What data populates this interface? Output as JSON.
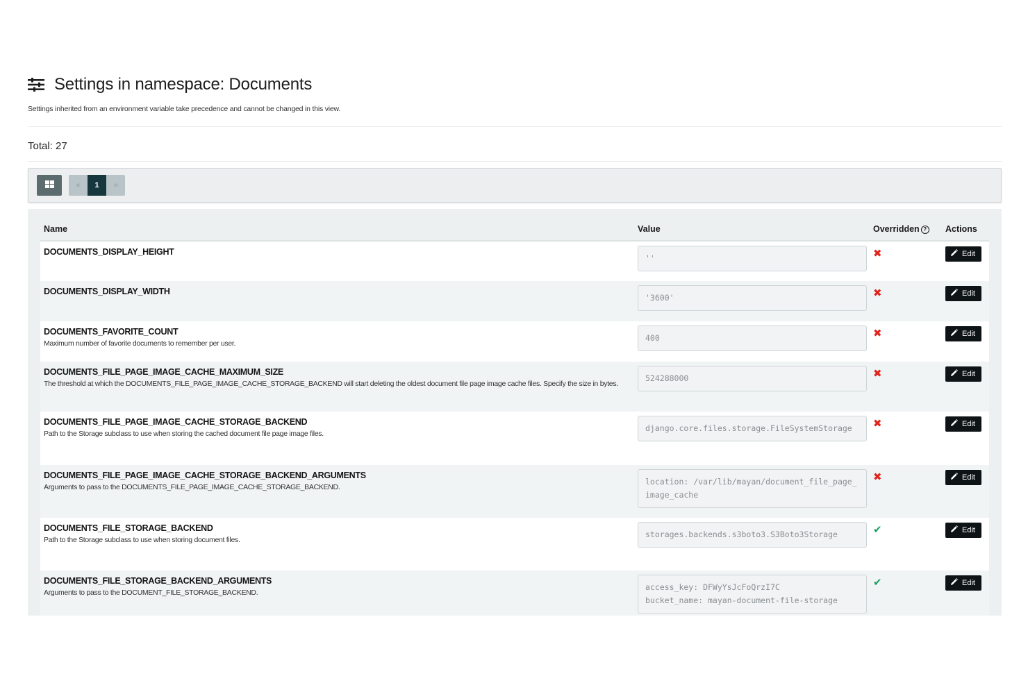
{
  "header": {
    "title": "Settings in namespace: Documents",
    "subtitle": "Settings inherited from an environment variable take precedence and cannot be changed in this view.",
    "icon": "sliders-icon"
  },
  "total_label": "Total: 27",
  "toolbar": {
    "view_icon": "grid-icon",
    "pager": {
      "prev": "«",
      "current": "1",
      "next": "»"
    }
  },
  "table": {
    "columns": {
      "name": "Name",
      "value": "Value",
      "overridden": "Overridden",
      "actions": "Actions"
    },
    "edit_label": "Edit",
    "rows": [
      {
        "name": "DOCUMENTS_DISPLAY_HEIGHT",
        "description": "",
        "value": "''",
        "overridden": false
      },
      {
        "name": "DOCUMENTS_DISPLAY_WIDTH",
        "description": "",
        "value": "'3600'",
        "overridden": false
      },
      {
        "name": "DOCUMENTS_FAVORITE_COUNT",
        "description": "Maximum number of favorite documents to remember per user.",
        "value": "400",
        "overridden": false
      },
      {
        "name": "DOCUMENTS_FILE_PAGE_IMAGE_CACHE_MAXIMUM_SIZE",
        "description": "The threshold at which the DOCUMENTS_FILE_PAGE_IMAGE_CACHE_STORAGE_BACKEND will start deleting the oldest document file page image cache files. Specify the size in bytes.",
        "value": "524288000",
        "overridden": false
      },
      {
        "name": "DOCUMENTS_FILE_PAGE_IMAGE_CACHE_STORAGE_BACKEND",
        "description": "Path to the Storage subclass to use when storing the cached document file page image files.",
        "value": "django.core.files.storage.FileSystemStorage",
        "overridden": false
      },
      {
        "name": "DOCUMENTS_FILE_PAGE_IMAGE_CACHE_STORAGE_BACKEND_ARGUMENTS",
        "description": "Arguments to pass to the DOCUMENTS_FILE_PAGE_IMAGE_CACHE_STORAGE_BACKEND.",
        "value": "location: /var/lib/mayan/document_file_page_image_cache",
        "overridden": false
      },
      {
        "name": "DOCUMENTS_FILE_STORAGE_BACKEND",
        "description": "Path to the Storage subclass to use when storing document files.",
        "value": "storages.backends.s3boto3.S3Boto3Storage",
        "overridden": true
      },
      {
        "name": "DOCUMENTS_FILE_STORAGE_BACKEND_ARGUMENTS",
        "description": "Arguments to pass to the DOCUMENT_FILE_STORAGE_BACKEND.",
        "value": "access_key: DFWyYsJcFoQrzI7C\nbucket_name: mayan-document-file-storage",
        "overridden": true
      }
    ]
  }
}
